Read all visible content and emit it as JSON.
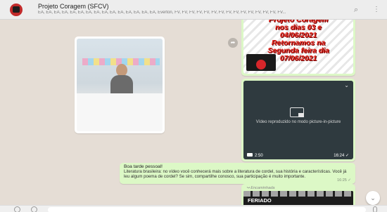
{
  "header": {
    "title": "Projeto Coragem (SFCV)",
    "participants": "EA, EA, EA, EA, EA, EA, EA, EA, EA, EA, EA, EA, EA, EA, EA, Everton, FV, FV, FV, FV, FV, FV, FV, FV, FV, FV, FV, FV, FV, FV, FV...",
    "search_icon": "⌕",
    "menu_icon": "⋮"
  },
  "messages": {
    "poster": {
      "text": "Projeto Coragem\nnos dias 03 e\n04/06/2021\nRetornamos na\nSegunda feira dia\n07/06/2021"
    },
    "video": {
      "pip_text": "Vídeo reproduzido no modo picture-in-picture",
      "duration": "2:50",
      "time": "16:24 ✓"
    },
    "text": {
      "title": "Boa tarde pessoal!",
      "body": "Literatura brasileira: no vídeo você conhecerá mais sobre a literatura de cordel, sua história e características. Você já leu algum poema de cordel? Se sim, compartilhe conosco, sua participação é muito importante.",
      "time": "16:25 ✓"
    },
    "forwarded": {
      "label": "↪ Encaminhada",
      "image_text": "FERIADO\nPROLONGADO."
    }
  },
  "controls": {
    "scroll_down": "⌄",
    "chevron": "⌄",
    "forward": "➦"
  }
}
